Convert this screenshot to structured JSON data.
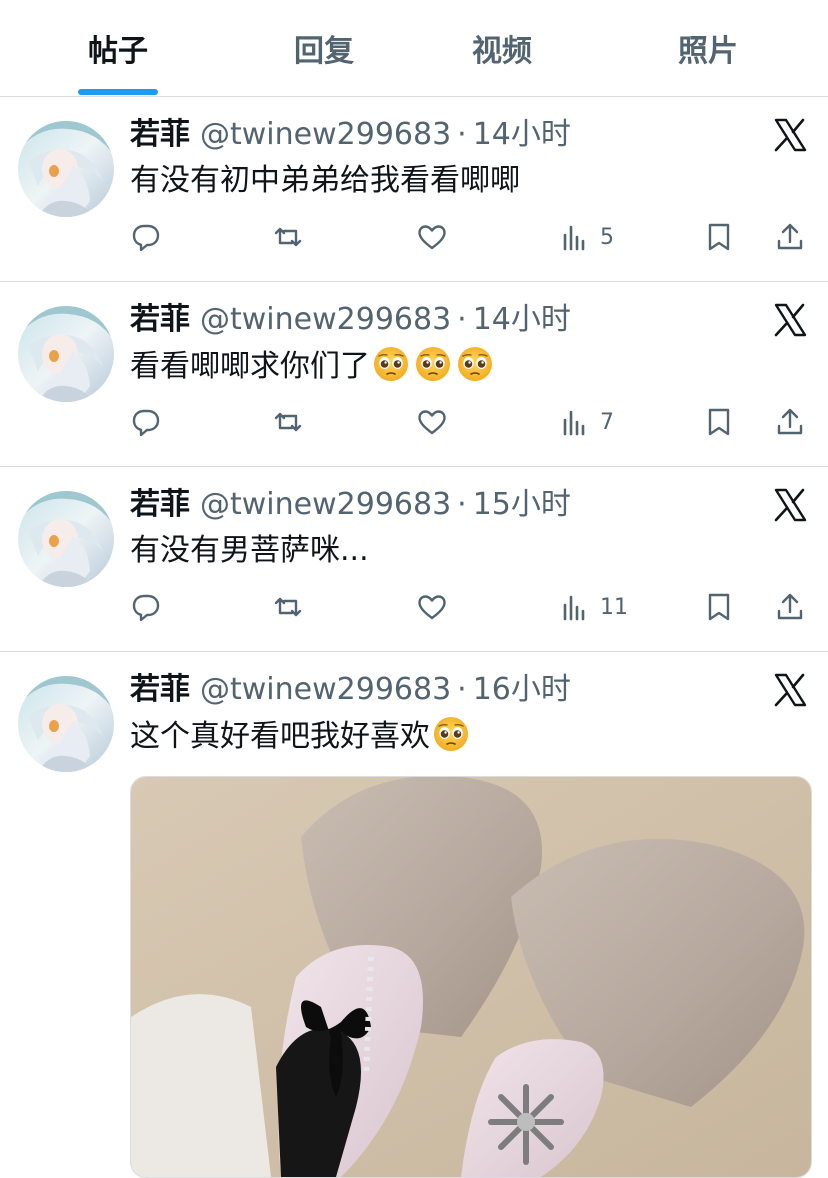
{
  "tabs": [
    "帖子",
    "回复",
    "视频",
    "照片"
  ],
  "posts": [
    {
      "name": "若菲",
      "handle": "@twinew299683",
      "dot": "·",
      "time": "14小时",
      "text": "有没有初中弟弟给我看看唧唧",
      "views": "5"
    },
    {
      "name": "若菲",
      "handle": "@twinew299683",
      "dot": "·",
      "time": "14小时",
      "text": "看看唧唧求你们了",
      "views": "7"
    },
    {
      "name": "若菲",
      "handle": "@twinew299683",
      "dot": "·",
      "time": "15小时",
      "text": "有没有男菩萨咪...",
      "views": "11"
    },
    {
      "name": "若菲",
      "handle": "@twinew299683",
      "dot": "·",
      "time": "16小时",
      "text": "这个真好看吧我好喜欢"
    }
  ],
  "icons": [
    "reply-icon",
    "retweet-icon",
    "like-icon",
    "views-icon",
    "bookmark-icon",
    "share-icon",
    "x-logo-icon",
    "pleading-face-emoji"
  ],
  "colors": {
    "accent": "#1d9bf0",
    "text": "#0f1419",
    "muted": "#536471",
    "divider": "#d9dde1"
  }
}
